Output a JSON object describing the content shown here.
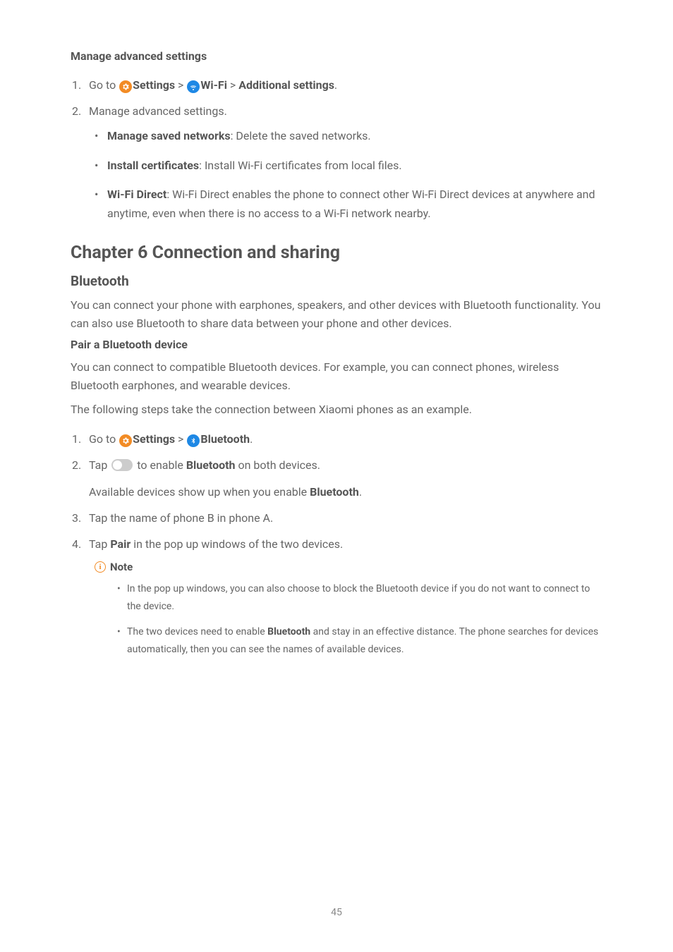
{
  "section1": {
    "heading": "Manage advanced settings",
    "step1_prefix": "Go to ",
    "settings_label": "Settings",
    "sep": " > ",
    "wifi_label": "Wi-Fi",
    "additional_label": "Additional settings",
    "step1_suffix": ".",
    "step2": "Manage advanced settings.",
    "bullets": {
      "b1_bold": "Manage saved networks",
      "b1_rest": ": Delete the saved networks.",
      "b2_bold": "Install certificates",
      "b2_rest": ": Install Wi-Fi certificates from local files.",
      "b3_bold": "Wi-Fi Direct",
      "b3_rest": ": Wi-Fi Direct enables the phone to connect other Wi-Fi Direct devices at anywhere and anytime, even when there is no access to a Wi-Fi network nearby."
    }
  },
  "chapter": {
    "title": "Chapter 6 Connection and sharing",
    "sub": "Bluetooth",
    "intro": "You can connect your phone with earphones, speakers, and other devices with Bluetooth functionality. You can also use Bluetooth to share data between your phone and other devices.",
    "pair_heading": "Pair a Bluetooth device",
    "pair_intro": "You can connect to compatible Bluetooth devices. For example, you can connect phones, wireless Bluetooth earphones, and wearable devices.",
    "pair_example": "The following steps take the connection between Xiaomi phones as an example.",
    "steps": {
      "s1_prefix": "Go to ",
      "settings_label": "Settings",
      "sep": " > ",
      "bt_label": "Bluetooth",
      "s1_suffix": ".",
      "s2_prefix": "Tap ",
      "s2_mid": " to enable ",
      "s2_bold": "Bluetooth",
      "s2_suffix": " on both devices.",
      "s2_avail_prefix": "Available devices show up when you enable ",
      "s2_avail_bold": "Bluetooth",
      "s2_avail_suffix": ".",
      "s3": "Tap the name of phone B in phone A.",
      "s4_prefix": "Tap ",
      "s4_bold": "Pair",
      "s4_suffix": " in the pop up windows of the two devices."
    }
  },
  "note": {
    "label": "Note",
    "n1": "In the pop up windows, you can also choose to block the Bluetooth device if you do not want to connect to the device.",
    "n2_prefix": "The two devices need to enable ",
    "n2_bold": "Bluetooth",
    "n2_suffix": " and stay in an effective distance. The phone searches for devices automatically, then you can see the names of available devices."
  },
  "page_number": "45"
}
